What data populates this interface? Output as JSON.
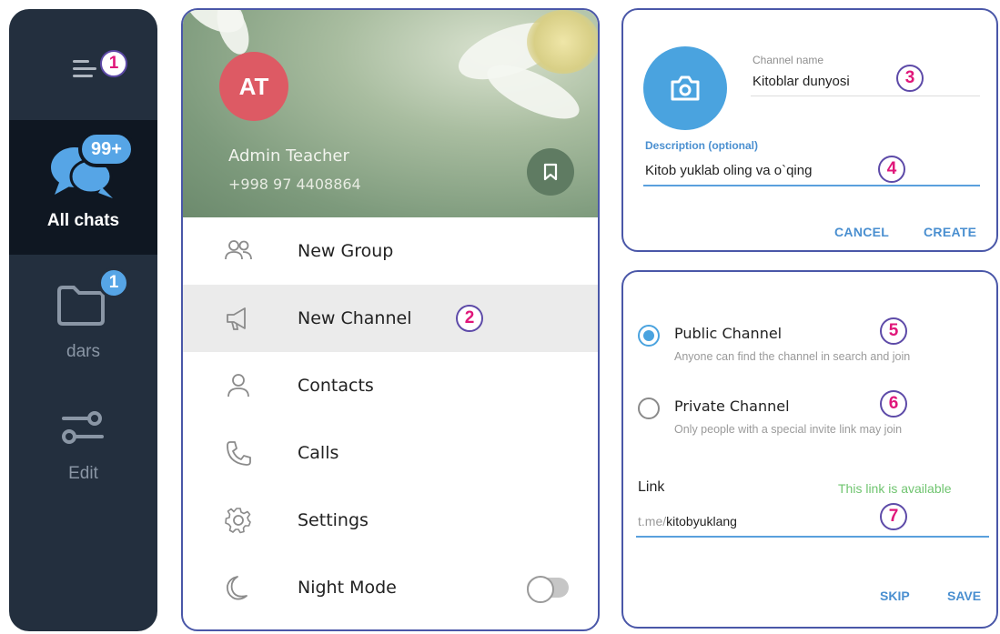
{
  "sidebar": {
    "menu_icon": "hamburger-icon",
    "annotation": "1",
    "folders": [
      {
        "label": "All chats",
        "badge": "99+",
        "icon": "chats-icon",
        "active": true
      },
      {
        "label": "dars",
        "badge": "1",
        "icon": "folder-icon",
        "active": false
      },
      {
        "label": "Edit",
        "badge": "",
        "icon": "sliders-icon",
        "active": false
      }
    ]
  },
  "menu": {
    "avatar_initials": "AT",
    "profile_name": "Admin Teacher",
    "profile_phone": "+998 97 4408864",
    "saved_icon": "bookmark-icon",
    "items": [
      {
        "label": "New Group",
        "icon": "group-icon"
      },
      {
        "label": "New Channel",
        "icon": "megaphone-icon",
        "annotation": "2"
      },
      {
        "label": "Contacts",
        "icon": "person-icon"
      },
      {
        "label": "Calls",
        "icon": "phone-icon"
      },
      {
        "label": "Settings",
        "icon": "gear-icon"
      },
      {
        "label": "Night Mode",
        "icon": "moon-icon",
        "toggle": false
      }
    ]
  },
  "create_channel": {
    "camera_icon": "camera-icon",
    "name_label": "Channel name",
    "name_value": "Kitoblar dunyosi",
    "name_annotation": "3",
    "desc_label": "Description (optional)",
    "desc_value": "Kitob yuklab oling va o`qing",
    "desc_annotation": "4",
    "cancel_label": "CANCEL",
    "create_label": "CREATE"
  },
  "channel_type": {
    "public_title": "Public Channel",
    "public_desc": "Anyone can find the channel in search and join",
    "public_annotation": "5",
    "private_title": "Private Channel",
    "private_desc": "Only people with a special invite link may join",
    "private_annotation": "6",
    "selected": "public",
    "link_label": "Link",
    "link_status": "This link is available",
    "link_prefix": "t.me/",
    "link_value": "kitobyuklang",
    "link_annotation": "7",
    "skip_label": "SKIP",
    "save_label": "SAVE"
  },
  "colors": {
    "sidebar_bg": "#232f3e",
    "accent_blue": "#4aa3df",
    "annotation_pink": "#e0177a",
    "annotation_ring": "#5d4aa8",
    "link_ok_green": "#6fc46f"
  }
}
